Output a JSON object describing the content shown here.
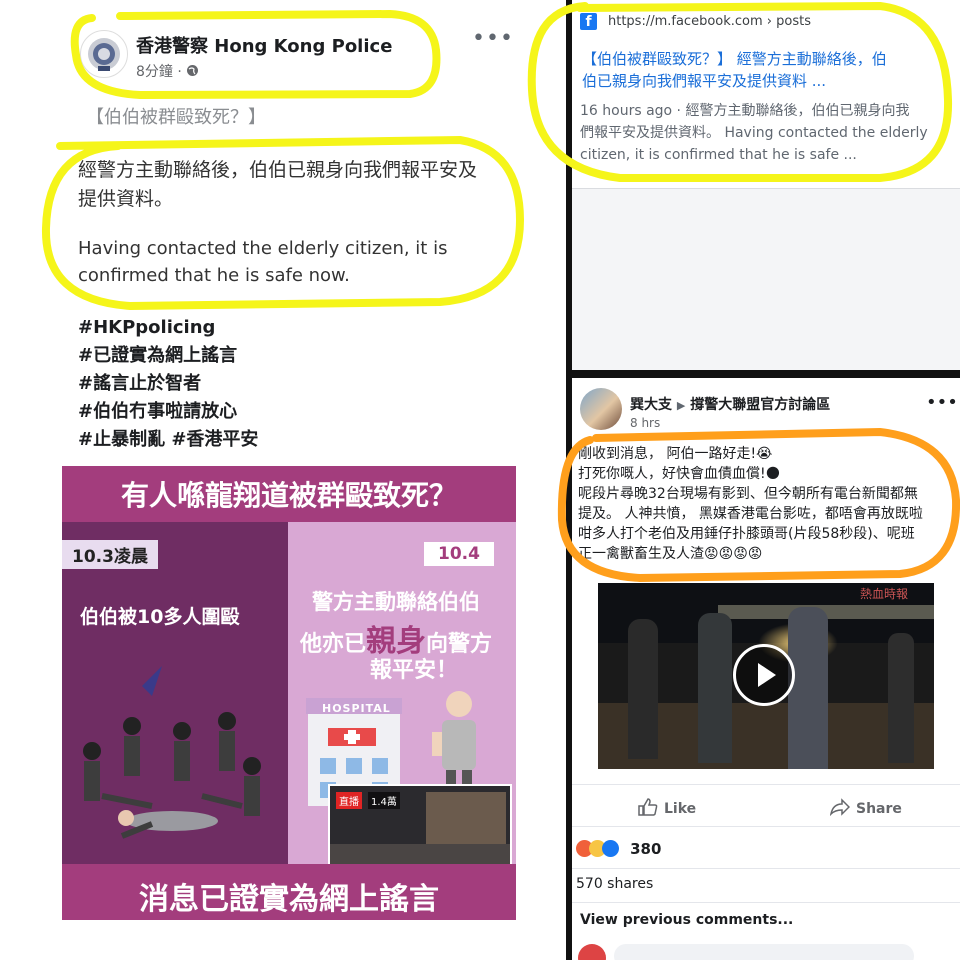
{
  "left_post": {
    "page_name": "香港警察 Hong Kong Police",
    "time": "8分鐘 · ",
    "title_partial": "【伯伯被群毆致死？】",
    "body_zh": [
      "經警方主動聯絡後，伯伯已親身向我們報平安及",
      "提供資料。"
    ],
    "body_en": [
      "Having contacted the elderly citizen, it is",
      "confirmed that he is safe now."
    ],
    "hashtags": [
      "#HKPpolicing",
      "#已證實為網上謠言",
      "#謠言止於智者",
      "#伯伯冇事啦請放心",
      "#止暴制亂 #香港平安"
    ],
    "poster": {
      "headline": "有人喺龍翔道被群毆致死？",
      "left_date": "10.3凌晨",
      "left_caption": "伯伯被10多人圍毆",
      "right_date": "10.4",
      "right_line1": "警方主動聯絡伯伯",
      "right_line2_pre": "他亦已",
      "right_line2_em": "親身",
      "right_line2_post": "向警方",
      "right_line3": "報平安！",
      "hospital": "HOSPITAL",
      "live_badge": "直播",
      "views": "1.4萬",
      "footer": "消息已證實為網上謠言"
    }
  },
  "search_result": {
    "url": "https://m.facebook.com › posts",
    "title": [
      "【伯伯被群毆致死？】 經警方主動聯絡後，伯",
      "伯已親身向我們報平安及提供資料 ..."
    ],
    "snippet": [
      "16 hours ago · 經警方主動聯絡後，伯伯已親身向我",
      "們報平安及提供資料。 Having contacted the elderly",
      "citizen, it is confirmed that he is safe ..."
    ]
  },
  "group_post": {
    "author": "巽大支",
    "group": "撐警大聯盟官方討論區",
    "time": "8 hrs",
    "lines": [
      "剛收到消息， 阿伯一路好走!😭",
      "打死你嘅人，好快會血債血償!🌑",
      "呢段片尋晚32台現場有影到、但今朝所有電台新聞都無",
      "提及。 人神共憤， 黑媒香港電台影咗，都唔會再放既啦",
      "咁多人打个老伯及用錘仔扑膝頭哥(片段58秒段)、呢班",
      "正一禽獸畜生及人渣😡😡😡😡"
    ],
    "video_watermark": "熱血時報",
    "like_label": "Like",
    "share_label": "Share",
    "reaction_count": "380",
    "shares": "570 shares",
    "view_comments": "View previous comments..."
  },
  "colors": {
    "highlight_yellow": "#f5f51a",
    "highlight_orange": "#ff9f1c",
    "poster_banner": "#a33d7d",
    "link_blue": "#1a6ed8"
  }
}
